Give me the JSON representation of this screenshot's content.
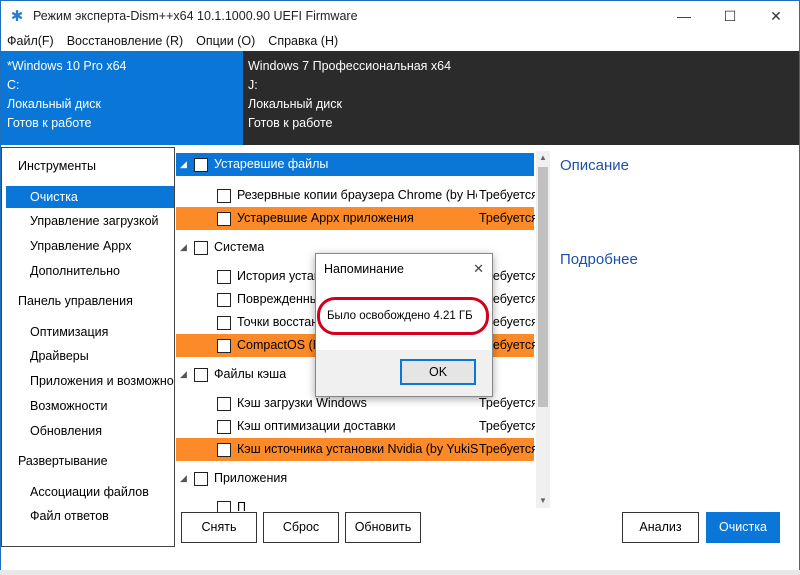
{
  "window": {
    "title": "Режим эксперта-Dism++x64 10.1.1000.90 UEFI Firmware",
    "minimize": "—",
    "maximize": "☐",
    "close": "✕",
    "icon": "gear-icon"
  },
  "menu": [
    "Файл(F)",
    "Восстановление (R)",
    "Опции (O)",
    "Справка (H)"
  ],
  "images": [
    {
      "name": "*Windows 10 Pro x64",
      "drive": "C:",
      "type": "Локальный диск",
      "status": "Готов к работе"
    },
    {
      "name": "Windows 7 Профессиональная x64",
      "drive": "J:",
      "type": "Локальный диск",
      "status": "Готов к работе"
    }
  ],
  "sidebar": {
    "sections": [
      {
        "title": "Инструменты",
        "items": [
          "Очистка",
          "Управление загрузкой",
          "Управление Appx",
          "Дополнительно"
        ]
      },
      {
        "title": "Панель управления",
        "items": [
          "Оптимизация",
          "Драйверы",
          "Приложения и возможности",
          "Возможности",
          "Обновления"
        ]
      },
      {
        "title": "Развертывание",
        "items": [
          "Ассоциации файлов",
          "Файл ответов"
        ]
      }
    ],
    "selected": "Очистка"
  },
  "list": {
    "rows": [
      {
        "kind": "group",
        "label": "Устаревшие файлы",
        "status": "",
        "style": "blue"
      },
      {
        "kind": "item",
        "label": "Резервные копии браузера Chrome (by Honr",
        "status": "Требуется",
        "style": ""
      },
      {
        "kind": "item",
        "label": "Устаревшие Appx приложения",
        "status": "Требуется",
        "style": "orange"
      },
      {
        "kind": "group",
        "label": "Система",
        "status": "",
        "style": ""
      },
      {
        "kind": "item",
        "label": "История устан",
        "status": "Требуется",
        "style": ""
      },
      {
        "kind": "item",
        "label": "Поврежденны",
        "status": "Требуется",
        "style": ""
      },
      {
        "kind": "item",
        "label": "Точки восстан",
        "status": "Требуется",
        "style": ""
      },
      {
        "kind": "item",
        "label": "CompactOS (M",
        "status": "Требуется",
        "style": "orange"
      },
      {
        "kind": "group",
        "label": "Файлы кэша",
        "status": "",
        "style": ""
      },
      {
        "kind": "item",
        "label": "Кэш загрузки Windows",
        "status": "Требуется",
        "style": ""
      },
      {
        "kind": "item",
        "label": "Кэш оптимизации доставки",
        "status": "Требуется",
        "style": ""
      },
      {
        "kind": "item",
        "label": "Кэш источника установки Nvidia (by YukiSaku",
        "status": "Требуется",
        "style": "orange"
      },
      {
        "kind": "group",
        "label": "Приложения",
        "status": "",
        "style": ""
      },
      {
        "kind": "item",
        "label": "П",
        "status": "",
        "style": ""
      }
    ]
  },
  "right_panel": {
    "description": "Описание",
    "details": "Подробнее"
  },
  "buttons": {
    "uncheck": "Снять",
    "reset": "Сброс",
    "refresh": "Обновить",
    "analyze": "Анализ",
    "clean": "Очистка"
  },
  "dialog": {
    "title": "Напоминание",
    "message": "Было освобождено 4.21 ГБ",
    "ok": "OK",
    "close": "✕"
  },
  "colors": {
    "accent": "#0a77d8",
    "highlight": "#fc8a28",
    "dark": "#2b2b2b",
    "annotation": "#d1001f"
  }
}
